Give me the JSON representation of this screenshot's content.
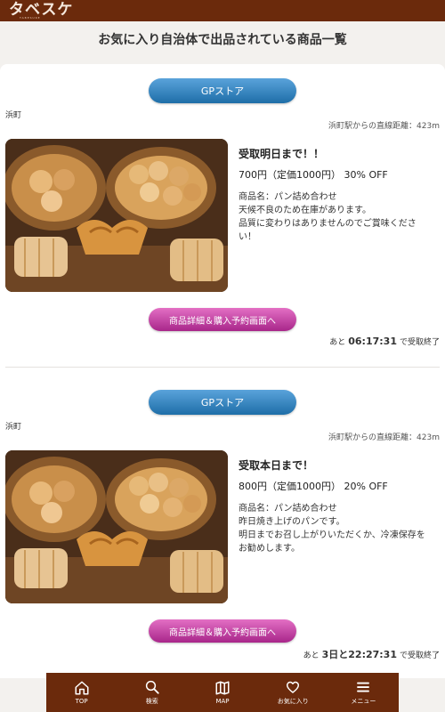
{
  "app": {
    "logo": "タベスケ",
    "logo_sub": "TABESUKE"
  },
  "page_title": "お気に入り自治体で出品されている商品一覧",
  "listings": [
    {
      "store_label": "GPストア",
      "area": "浜町",
      "distance": "浜町駅からの直線距離：423m",
      "deadline": "受取明日まで！！",
      "price": "700円",
      "regular_price": "（定価1000円）",
      "discount": "30% OFF",
      "description": [
        "商品名：パン詰め合わせ",
        "天候不良のため在庫があります。",
        "品質に変わりはありませんのでご賞味くださ",
        "い！"
      ],
      "detail_button": "商品詳細＆購入予約画面へ",
      "countdown_prefix": "あと",
      "countdown_time": "06:17:31",
      "countdown_suffix": "で受取終了"
    },
    {
      "store_label": "GPストア",
      "area": "浜町",
      "distance": "浜町駅からの直線距離：423m",
      "deadline": "受取本日まで！",
      "price": "800円",
      "regular_price": "（定価1000円）",
      "discount": "20% OFF",
      "description": [
        "商品名：パン詰め合わせ",
        "昨日焼き上げのパンです。",
        "明日までお召し上がりいただくか、冷凍保存を",
        "お勧めします。"
      ],
      "detail_button": "商品詳細＆購入予約画面へ",
      "countdown_prefix": "あと",
      "countdown_time": "3日と22:27:31",
      "countdown_suffix": "で受取終了"
    }
  ],
  "tabbar": [
    {
      "label": "TOP",
      "icon": "home-icon"
    },
    {
      "label": "検索",
      "icon": "search-icon"
    },
    {
      "label": "MAP",
      "icon": "map-icon"
    },
    {
      "label": "お気に入り",
      "icon": "heart-icon"
    },
    {
      "label": "メニュー",
      "icon": "menu-icon"
    }
  ],
  "colors": {
    "brand": "#6b2a0c",
    "store_button": "#2a7fc0",
    "detail_button": "#c23da3"
  }
}
